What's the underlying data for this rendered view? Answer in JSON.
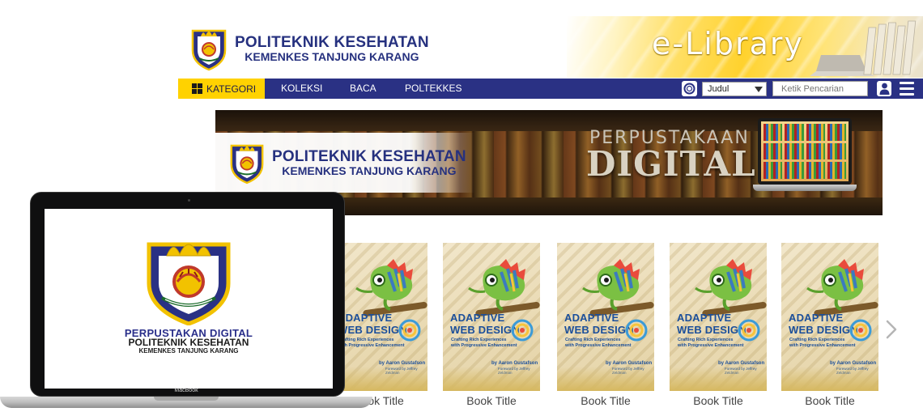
{
  "header": {
    "org_name": "POLITEKNIK KESEHATAN",
    "org_subname": "KEMENKES TANJUNG KARANG",
    "banner_text": "e-Library"
  },
  "nav": {
    "category_label": "KATEGORI",
    "items": [
      {
        "label": "KOLEKSI"
      },
      {
        "label": "BACA"
      },
      {
        "label": "POLTEKKES"
      }
    ],
    "search_type_selected": "Judul",
    "search_placeholder": "Ketik Pencarian"
  },
  "hero": {
    "org_name": "POLITEKNIK KESEHATAN",
    "org_subname": "KEMENKES TANJUNG KARANG",
    "title_line1": "PERPUSTAKAAN",
    "title_line2": "DIGITAL"
  },
  "laptop_screen": {
    "line1": "PERPUSTAKAN DIGITAL",
    "line2": "POLITEKNIK KESEHATAN",
    "line3": "KEMENKES TANJUNG KARANG",
    "brand": "MacBook"
  },
  "books": [
    {
      "title": "Book Title",
      "cover_title_1": "ADAPTIVE",
      "cover_title_2": "WEB DESIGN",
      "cover_sub_1": "Crafting Rich Experiences",
      "cover_sub_2": "with Progressive Enhancement",
      "cover_author": "by Aaron Gustafson",
      "cover_foreword": "Foreword by Jeffrey Zeldman"
    },
    {
      "title": "Book Title",
      "cover_title_1": "ADAPTIVE",
      "cover_title_2": "WEB DESIGN",
      "cover_sub_1": "Crafting Rich Experiences",
      "cover_sub_2": "with Progressive Enhancement",
      "cover_author": "by Aaron Gustafson",
      "cover_foreword": "Foreword by Jeffrey Zeldman"
    },
    {
      "title": "Book Title",
      "cover_title_1": "ADAPTIVE",
      "cover_title_2": "WEB DESIGN",
      "cover_sub_1": "Crafting Rich Experiences",
      "cover_sub_2": "with Progressive Enhancement",
      "cover_author": "by Aaron Gustafson",
      "cover_foreword": "Foreword by Jeffrey Zeldman"
    },
    {
      "title": "Book Title",
      "cover_title_1": "ADAPTIVE",
      "cover_title_2": "WEB DESIGN",
      "cover_sub_1": "Crafting Rich Experiences",
      "cover_sub_2": "with Progressive Enhancement",
      "cover_author": "by Aaron Gustafson",
      "cover_foreword": "Foreword by Jeffrey Zeldman"
    },
    {
      "title": "Book Title",
      "cover_title_1": "ADAPTIVE",
      "cover_title_2": "WEB DESIGN",
      "cover_sub_1": "Crafting Rich Experiences",
      "cover_sub_2": "with Progressive Enhancement",
      "cover_author": "by Aaron Gustafson",
      "cover_foreword": "Foreword by Jeffrey Zeldman"
    }
  ],
  "icons": {
    "category": "grid-icon",
    "search": "search-icon",
    "dropdown": "chevron-down-icon",
    "user": "user-icon",
    "menu": "hamburger-menu-icon",
    "next": "chevron-right-icon"
  },
  "colors": {
    "nav_bg": "#2a3184",
    "accent_yellow": "#ffd200",
    "brand_blue": "#26317f",
    "cover_title": "#1b4f9b"
  }
}
